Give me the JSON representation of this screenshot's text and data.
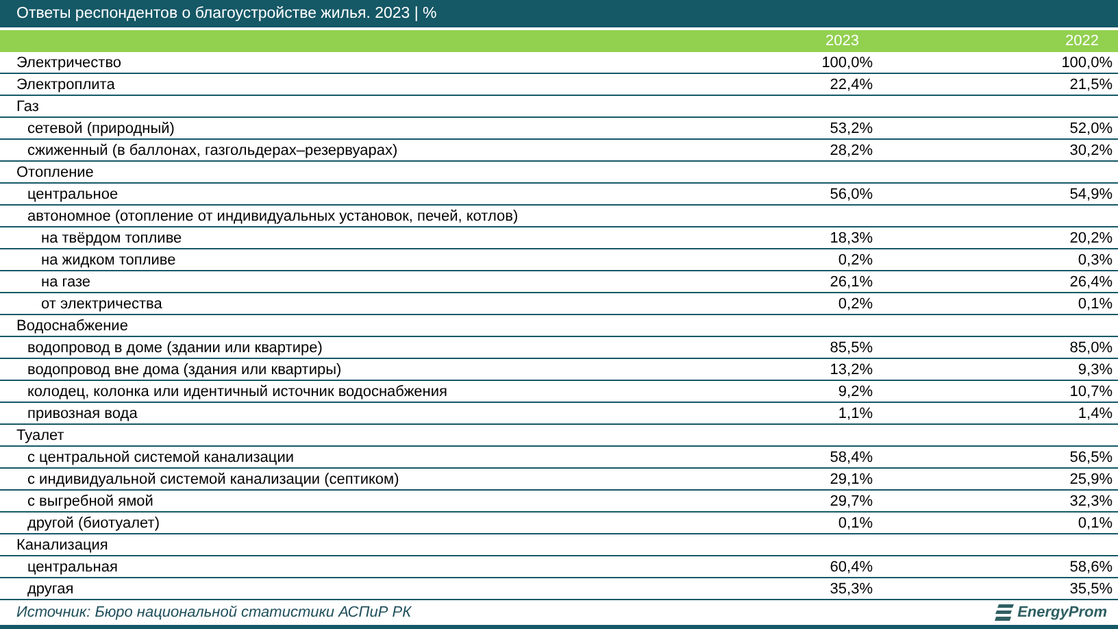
{
  "title": "Ответы респондентов о благоустройстве жилья. 2023 | %",
  "columns": [
    "2023",
    "2022"
  ],
  "rows": [
    {
      "label": "Электричество",
      "values": [
        "100,0%",
        "100,0%"
      ]
    },
    {
      "label": "Электроплита",
      "values": [
        "22,4%",
        "21,5%"
      ]
    },
    {
      "label": "Газ",
      "children": [
        {
          "label": "сетевой (природный)",
          "values": [
            "53,2%",
            "52,0%"
          ]
        },
        {
          "label": "сжиженный (в баллонах, газгольдерах–резервуарах)",
          "values": [
            "28,2%",
            "30,2%"
          ]
        }
      ]
    },
    {
      "label": "Отопление",
      "children": [
        {
          "label": "центральное",
          "values": [
            "56,0%",
            "54,9%"
          ]
        },
        {
          "label": "автономное (отопление от индивидуальных установок, печей, котлов)",
          "children": [
            {
              "label": "на твёрдом топливе",
              "values": [
                "18,3%",
                "20,2%"
              ]
            },
            {
              "label": "на жидком топливе",
              "values": [
                "0,2%",
                "0,3%"
              ]
            },
            {
              "label": "на газе",
              "values": [
                "26,1%",
                "26,4%"
              ]
            },
            {
              "label": "от электричества",
              "values": [
                "0,2%",
                "0,1%"
              ]
            }
          ]
        }
      ]
    },
    {
      "label": "Водоснабжение",
      "children": [
        {
          "label": "водопровод в доме (здании или квартире)",
          "values": [
            "85,5%",
            "85,0%"
          ]
        },
        {
          "label": "водопровод вне дома (здания или квартиры)",
          "values": [
            "13,2%",
            "9,3%"
          ]
        },
        {
          "label": "колодец, колонка или идентичный источник водоснабжения",
          "values": [
            "9,2%",
            "10,7%"
          ]
        },
        {
          "label": "привозная вода",
          "values": [
            "1,1%",
            "1,4%"
          ]
        }
      ]
    },
    {
      "label": "Туалет",
      "children": [
        {
          "label": "с центральной системой канализации",
          "values": [
            "58,4%",
            "56,5%"
          ]
        },
        {
          "label": "с индивидуальной системой канализации (септиком)",
          "values": [
            "29,1%",
            "25,9%"
          ]
        },
        {
          "label": "с выгребной ямой",
          "values": [
            "29,7%",
            "32,3%"
          ]
        },
        {
          "label": "другой (биотуалет)",
          "values": [
            "0,1%",
            "0,1%"
          ]
        }
      ]
    },
    {
      "label": "Канализация",
      "children": [
        {
          "label": "центральная",
          "values": [
            "60,4%",
            "58,6%"
          ]
        },
        {
          "label": "другая",
          "values": [
            "35,3%",
            "35,5%"
          ]
        }
      ]
    }
  ],
  "source": "Источник: Бюро национальной статистики АСПиР РК",
  "logo": "EnergyProm"
}
